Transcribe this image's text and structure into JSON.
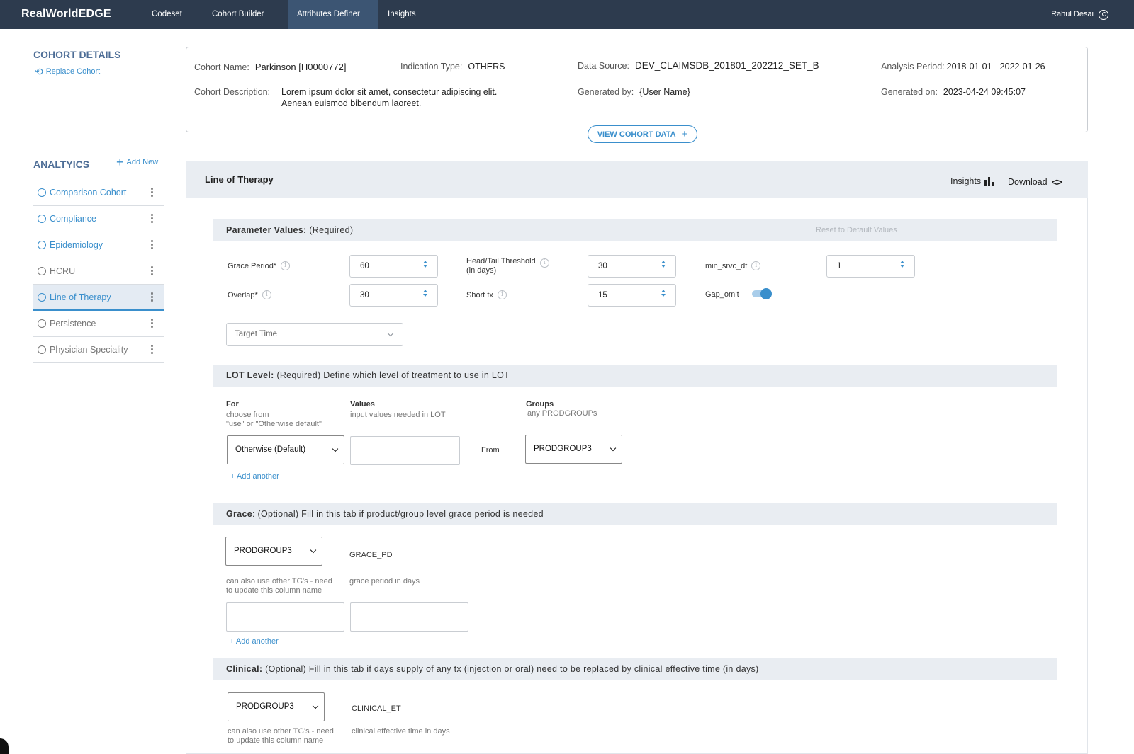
{
  "app": {
    "brand": "RealWorldEDGE",
    "user_name": "Rahul Desai"
  },
  "nav": {
    "tabs": [
      {
        "label": "Codeset"
      },
      {
        "label": "Cohort Builder"
      },
      {
        "label": "Attributes Definer"
      },
      {
        "label": "Insights"
      }
    ],
    "active": "Attributes Definer"
  },
  "cohort_details": {
    "title": "COHORT DETAILS",
    "replace_label": "Replace Cohort",
    "name_label": "Cohort Name:",
    "name_value": "Parkinson  [H0000772]",
    "indication_label": "Indication Type:",
    "indication_value": "OTHERS",
    "source_label": "Data Source:",
    "source_value": "DEV_CLAIMSDB_201801_202212_SET_B",
    "period_label": "Analysis Period:",
    "period_value": "2018-01-01 - 2022-01-26",
    "description_label": "Cohort Description:",
    "description_line1": "Lorem ipsum dolor sit amet, consectetur adipiscing elit.",
    "description_line2": "Aenean euismod bibendum laoreet.",
    "generated_by_label": "Generated by:",
    "generated_by_value": "{User Name}",
    "generated_on_label": "Generated on:",
    "generated_on_value": "2023-04-24 09:45:07",
    "view_button": "VIEW COHORT DATA"
  },
  "analytics": {
    "title": "ANALTYICS",
    "add_new": "Add New",
    "items": [
      {
        "label": "Comparison Cohort"
      },
      {
        "label": "Compliance"
      },
      {
        "label": "Epidemiology"
      },
      {
        "label": "HCRU"
      },
      {
        "label": "Line of Therapy"
      },
      {
        "label": "Persistence"
      },
      {
        "label": "Physician Speciality"
      }
    ],
    "selected": "Line of Therapy"
  },
  "panel": {
    "title": "Line of Therapy",
    "insights_label": "Insights",
    "download_label": "Download"
  },
  "parameters": {
    "heading_bold": "Parameter Values:",
    "heading_rest": " (Required)",
    "reset_label": "Reset to Default Values",
    "grace_label": "Grace Period*",
    "grace_value": "60",
    "overlap_label": "Overlap*",
    "overlap_value": "30",
    "headtail_label_line1": "Head/Tail Threshold",
    "headtail_label_line2": "(in days)",
    "headtail_value": "30",
    "shorttx_label": "Short tx",
    "shorttx_value": "15",
    "minsrvc_label": "min_srvc_dt",
    "minsrvc_value": "1",
    "gapomit_label": "Gap_omit",
    "gapomit_on": true,
    "target_placeholder": "Target Time"
  },
  "lot": {
    "heading_bold": "LOT Level:",
    "heading_rest": " (Required) Define which level of treatment to use in LOT",
    "for_label": "For",
    "for_sub1": "choose from",
    "for_sub2": "\"use\" or \"Otherwise default\"",
    "values_label": "Values",
    "values_sub": "input values needed in LOT",
    "groups_label": "Groups",
    "groups_sub": "any PRODGROUPs",
    "for_select": "Otherwise (Default)",
    "from_label": "From",
    "group_select": "PRODGROUP3",
    "add_another": "+ Add another"
  },
  "grace": {
    "heading_bold": "Grace",
    "heading_rest": ": (Optional) Fill in this tab if product/group level grace period is needed",
    "select_value": "PRODGROUP3",
    "col_label": "GRACE_PD",
    "note_line1": "can also use other TG's - need",
    "note_line2": "to update this column name",
    "col_sub": "grace period in days",
    "add_another": "+ Add another"
  },
  "clinical": {
    "heading_bold": "Clinical:",
    "heading_rest": " (Optional) Fill in this tab if days supply of any tx (injection or oral) need to be replaced by clinical effective time (in days)",
    "select_value": "PRODGROUP3",
    "col_label": "CLINICAL_ET",
    "note_line1": "can also use other TG's - need",
    "note_line2": "to update this column name",
    "col_sub": "clinical effective time in days"
  }
}
